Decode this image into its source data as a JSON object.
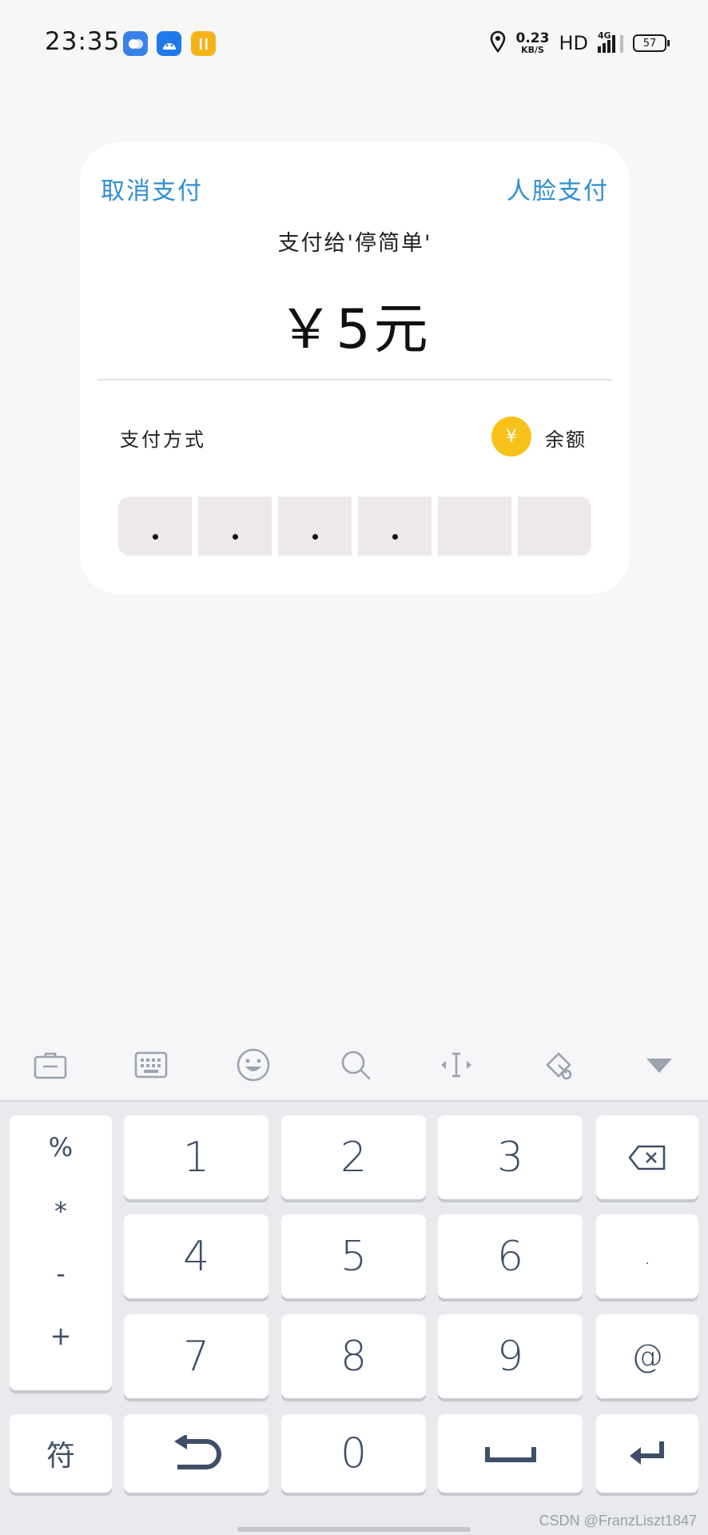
{
  "status_bar": {
    "time": "23:35",
    "speed_value": "0.23",
    "speed_unit": "KB/S",
    "hd": "HD",
    "network": "4G",
    "battery": "57"
  },
  "payment": {
    "cancel_label": "取消支付",
    "face_pay_label": "人脸支付",
    "payee": "支付给'停简单'",
    "amount": "￥5元",
    "method_label": "支付方式",
    "method_icon": "¥",
    "method_value": "余额",
    "pin_length": 6,
    "pin_filled": 4
  },
  "keyboard": {
    "toolbar": [
      "toolbox",
      "keyboard",
      "emoji",
      "search",
      "cursor",
      "clipboard",
      "collapse"
    ],
    "symbols": [
      "%",
      "*",
      "-",
      "+"
    ],
    "keys": {
      "k1": "1",
      "k2": "2",
      "k3": "3",
      "k4": "4",
      "k5": "5",
      "k6": "6",
      "k7": "7",
      "k8": "8",
      "k9": "9",
      "k0": "0",
      "dot": ".",
      "at": "@",
      "fu": "符"
    }
  },
  "watermark": "CSDN @FranzLiszt1847",
  "colors": {
    "accent": "#2f8fd2",
    "coin": "#f8c21a",
    "pin_cell": "#ece9e8",
    "key_text": "#3f4f66"
  }
}
